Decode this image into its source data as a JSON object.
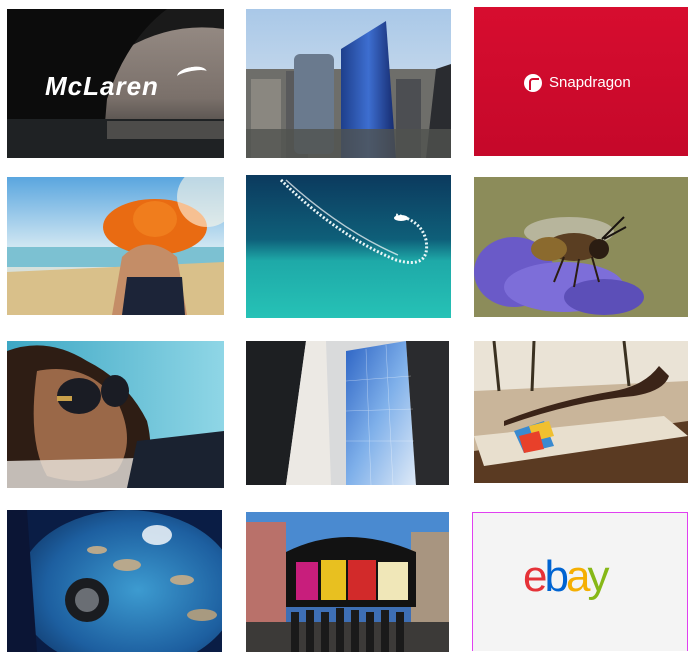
{
  "gallery": {
    "tiles": [
      {
        "id": "mclaren",
        "alt": "McLaren",
        "logo_text": "McLaren"
      },
      {
        "id": "city",
        "alt": "City skyline"
      },
      {
        "id": "snapdragon",
        "alt": "Snapdragon",
        "logo_text": "Snapdragon"
      },
      {
        "id": "beach-hat",
        "alt": "Woman in orange hat at beach"
      },
      {
        "id": "jetski",
        "alt": "Jet ski aerial"
      },
      {
        "id": "bee",
        "alt": "Bee on purple flower"
      },
      {
        "id": "sunglasses",
        "alt": "Woman with sunglasses"
      },
      {
        "id": "tower",
        "alt": "Glass tower"
      },
      {
        "id": "sunbather",
        "alt": "Man sunbathing"
      },
      {
        "id": "plane-window",
        "alt": "Airplane window view"
      },
      {
        "id": "piccadilly",
        "alt": "Group at Piccadilly Circus"
      },
      {
        "id": "ebay",
        "alt": "eBay",
        "logo_text": "ebay"
      }
    ]
  },
  "colors": {
    "snapdragon_red": "#d20a2e",
    "ebay_red": "#e53238",
    "ebay_blue": "#0064d2",
    "ebay_yellow": "#f5af02",
    "ebay_green": "#86b817",
    "selected_border": "#e040f0"
  }
}
